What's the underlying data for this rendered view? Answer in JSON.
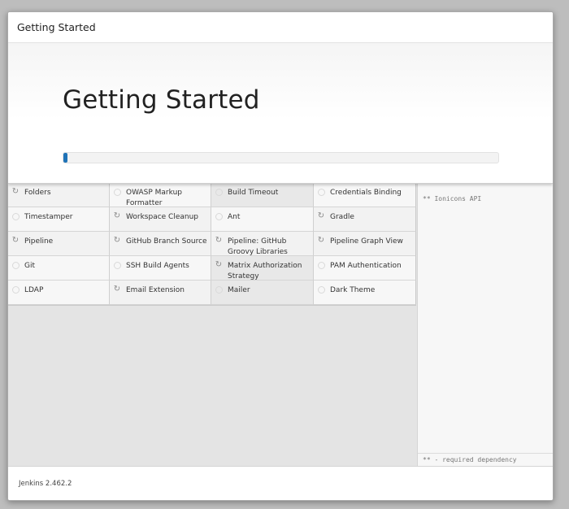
{
  "dialog": {
    "header_title": "Getting Started",
    "hero_title": "Getting Started",
    "progress_fraction": 0.01,
    "progress_color": "#1f73b7"
  },
  "plugins": [
    {
      "label": "Folders",
      "state": "installing",
      "icon": "refresh-icon"
    },
    {
      "label": "OWASP Markup Formatter",
      "state": "pending",
      "icon": "idle-circle-icon"
    },
    {
      "label": "Build Timeout",
      "state": "working",
      "icon": "idle-circle-icon"
    },
    {
      "label": "Credentials Binding",
      "state": "pending",
      "icon": "idle-circle-icon"
    },
    {
      "label": "Timestamper",
      "state": "pending",
      "icon": "idle-circle-icon"
    },
    {
      "label": "Workspace Cleanup",
      "state": "installing",
      "icon": "refresh-icon"
    },
    {
      "label": "Ant",
      "state": "pending",
      "icon": "idle-circle-icon"
    },
    {
      "label": "Gradle",
      "state": "installing",
      "icon": "refresh-icon"
    },
    {
      "label": "Pipeline",
      "state": "installing",
      "icon": "refresh-icon"
    },
    {
      "label": "GitHub Branch Source",
      "state": "installing",
      "icon": "refresh-icon"
    },
    {
      "label": "Pipeline: GitHub Groovy Libraries",
      "state": "installing",
      "icon": "refresh-icon"
    },
    {
      "label": "Pipeline Graph View",
      "state": "installing",
      "icon": "refresh-icon"
    },
    {
      "label": "Git",
      "state": "pending",
      "icon": "idle-circle-icon"
    },
    {
      "label": "SSH Build Agents",
      "state": "pending",
      "icon": "idle-circle-icon"
    },
    {
      "label": "Matrix Authorization Strategy",
      "state": "working",
      "icon": "refresh-icon"
    },
    {
      "label": "PAM Authentication",
      "state": "pending",
      "icon": "idle-circle-icon"
    },
    {
      "label": "LDAP",
      "state": "pending",
      "icon": "idle-circle-icon"
    },
    {
      "label": "Email Extension",
      "state": "installing",
      "icon": "refresh-icon"
    },
    {
      "label": "Mailer",
      "state": "working",
      "icon": "idle-circle-icon"
    },
    {
      "label": "Dark Theme",
      "state": "pending",
      "icon": "idle-circle-icon"
    }
  ],
  "log": {
    "text": "** Ionicons API",
    "footer": "** - required dependency"
  },
  "footer": {
    "version": "Jenkins 2.462.2"
  }
}
